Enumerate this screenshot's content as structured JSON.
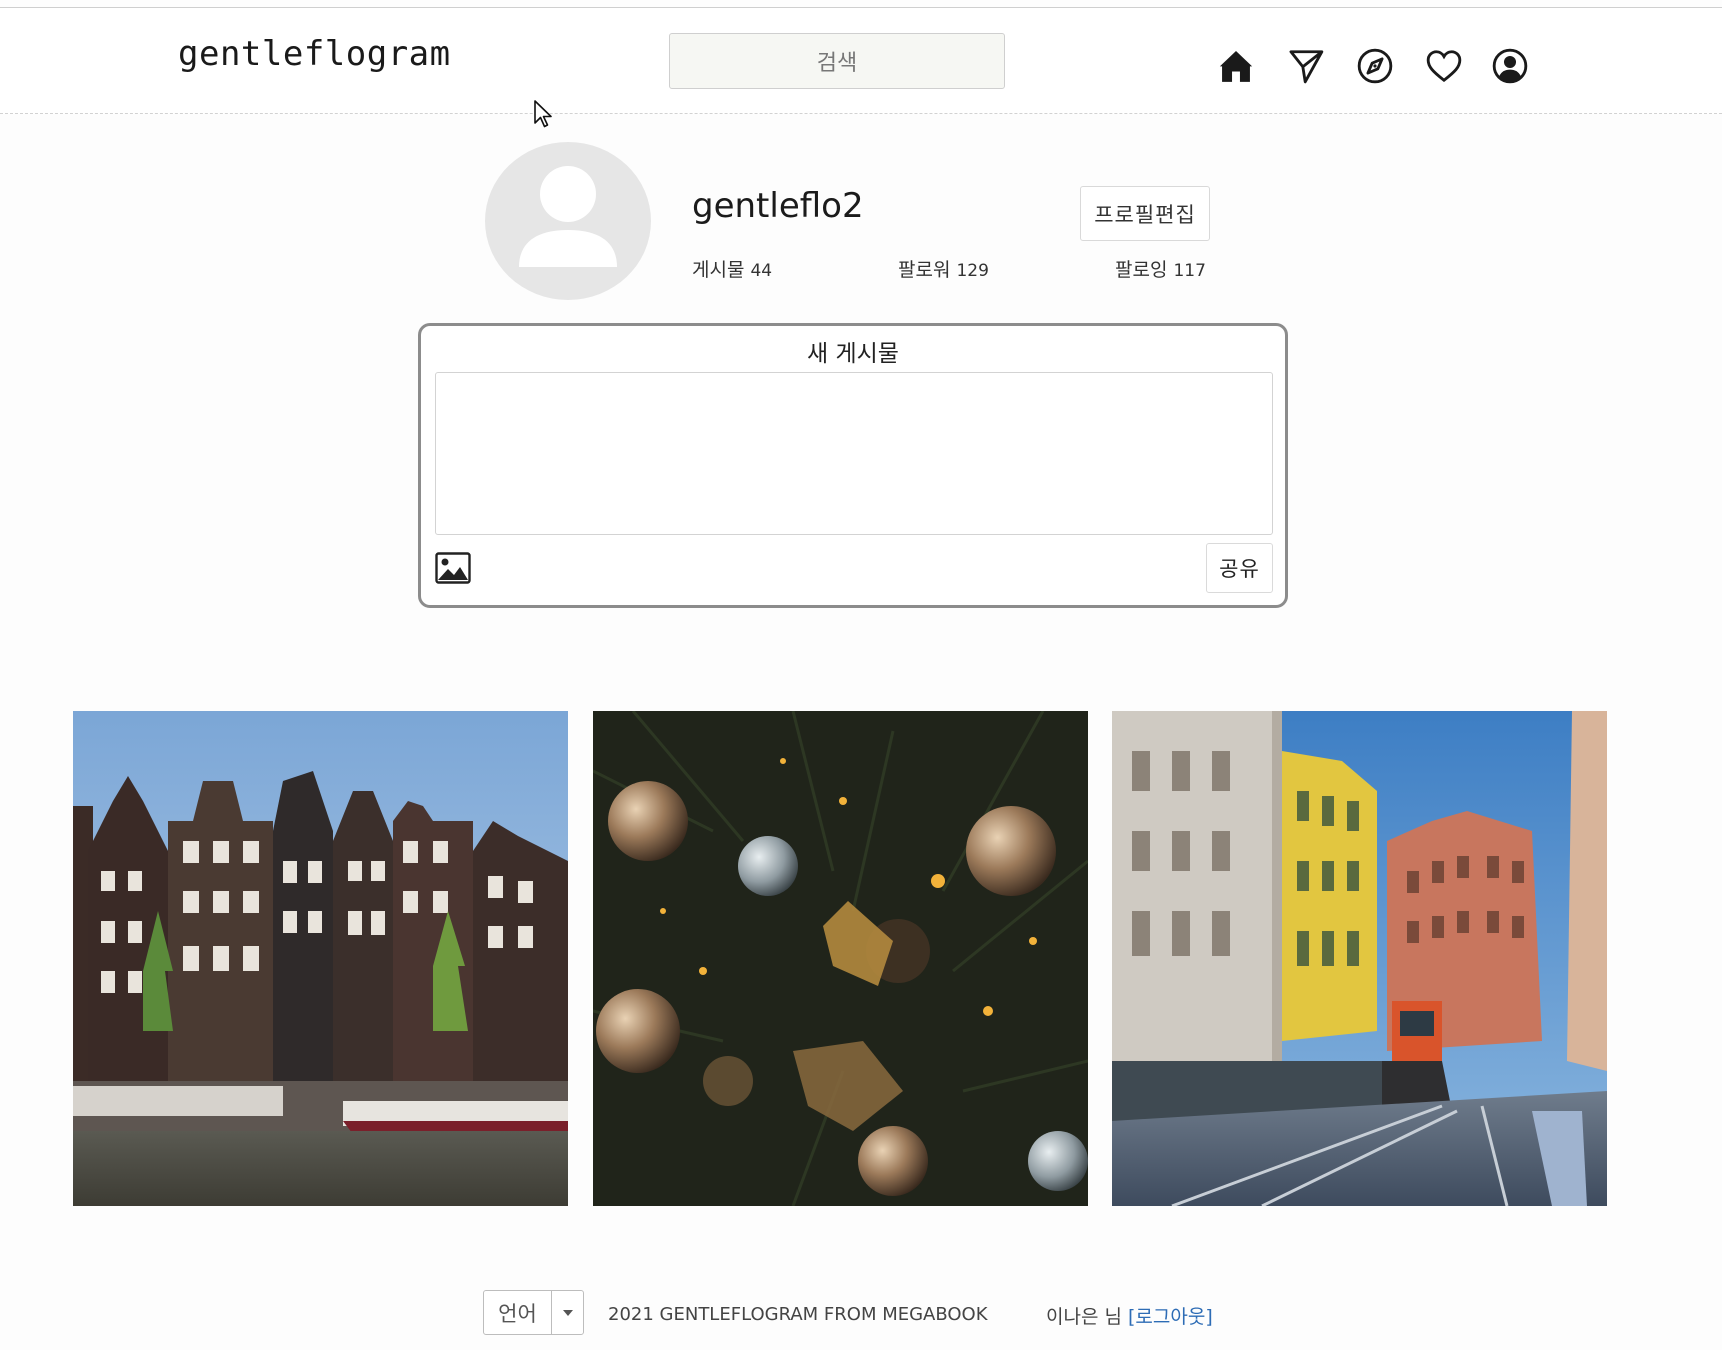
{
  "header": {
    "logo": "gentleflogram",
    "search_placeholder": "검색",
    "nav_icons": [
      "home-icon",
      "send-icon",
      "explore-compass-icon",
      "heart-icon",
      "profile-icon"
    ]
  },
  "profile": {
    "username": "gentleflo2",
    "edit_button": "프로필편집",
    "stats": [
      {
        "label": "게시물",
        "value": "44"
      },
      {
        "label": "팔로워",
        "value": "129"
      },
      {
        "label": "팔로잉",
        "value": "117"
      }
    ]
  },
  "composer": {
    "title": "새 게시물",
    "text_value": "",
    "share_button": "공유"
  },
  "posts": [
    {
      "subject": "canal-houses"
    },
    {
      "subject": "christmas-ornaments"
    },
    {
      "subject": "city-street-tram"
    }
  ],
  "footer": {
    "language_button": "언어",
    "copyright": "2021 GENTLEFLOGRAM FROM MEGABOOK",
    "user_text": "이나은 님",
    "logout_link": "[로그아웃]"
  },
  "colors": {
    "link": "#2d6cb5",
    "composer_border": "#8c8c8c",
    "avatar_bg": "#e6e6e6"
  }
}
